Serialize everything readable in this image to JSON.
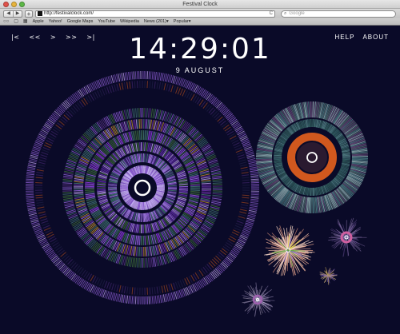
{
  "window": {
    "title": "Festival Clock"
  },
  "toolbar": {
    "back_icon": "◀",
    "forward_icon": "▶",
    "add_icon": "+",
    "url": "http://festivalclock.com/",
    "reload_icon": "C",
    "search_placeholder": "Google"
  },
  "bookmarks": {
    "items": [
      "Apple",
      "Yahoo!",
      "Google Maps",
      "YouTube",
      "Wikipedia",
      "News (201)▾",
      "Popular▾"
    ]
  },
  "page": {
    "nav_controls": [
      "|<",
      "<<",
      ">",
      ">>",
      ">|"
    ],
    "links": [
      "HELP",
      "ABOUT"
    ],
    "time": "14:29:01",
    "date": "9 AUGUST"
  },
  "colors": {
    "background": "#0a0a28",
    "purple": "#8a5cd0",
    "lavender": "#b89ae8",
    "teal": "#3c6a6a",
    "green": "#3c6a3a",
    "orange": "#d0581e",
    "peach": "#f0c0a8"
  }
}
